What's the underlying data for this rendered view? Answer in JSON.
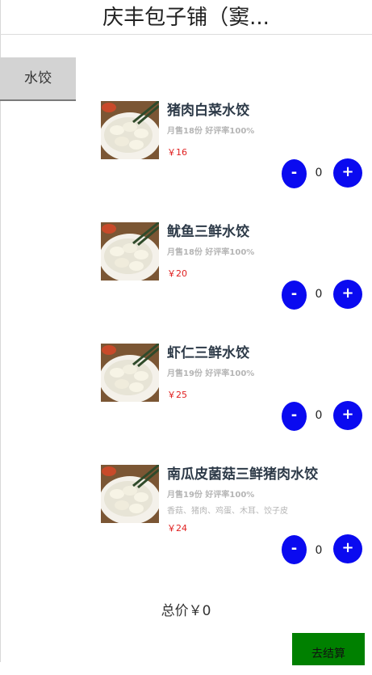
{
  "header": {
    "title": "庆丰包子铺（窦..."
  },
  "category": {
    "label": "水饺"
  },
  "items": [
    {
      "name": "猪肉白菜水饺",
      "meta": "月售18份 好评率100%",
      "desc": "",
      "price": "￥16",
      "qty": "0",
      "minus": "-",
      "plus": "+",
      "image": "dumplings-photo"
    },
    {
      "name": "鱿鱼三鲜水饺",
      "meta": "月售18份 好评率100%",
      "desc": "",
      "price": "￥20",
      "qty": "0",
      "minus": "-",
      "plus": "+",
      "image": "dumplings-photo"
    },
    {
      "name": "虾仁三鲜水饺",
      "meta": "月售19份 好评率100%",
      "desc": "",
      "price": "￥25",
      "qty": "0",
      "minus": "-",
      "plus": "+",
      "image": "dumplings-photo"
    },
    {
      "name": "南瓜皮菌菇三鲜猪肉水饺",
      "meta": "月售19份 好评率100%",
      "desc": "香菇、猪肉、鸡蛋、木耳、饺子皮",
      "price": "￥24",
      "qty": "0",
      "minus": "-",
      "plus": "+",
      "image": "dumplings-photo"
    }
  ],
  "footer": {
    "total": "总价￥0",
    "checkout_label": "去结算"
  },
  "colors": {
    "button_blue": "#0a0af0",
    "price_red": "#e02020",
    "checkout_green": "#008000",
    "category_bg": "#d3d3d3"
  }
}
